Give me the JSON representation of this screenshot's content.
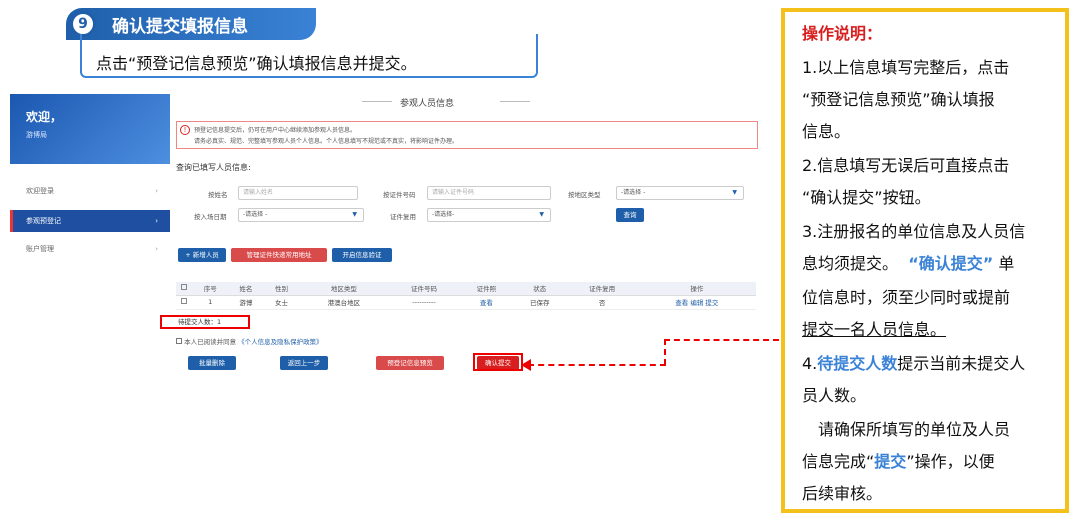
{
  "step": {
    "number": "9",
    "title": "确认提交填报信息",
    "desc": "点击“预登记信息预览”确认填报信息并提交。"
  },
  "sidebar": {
    "welcome_title": "欢迎，",
    "welcome_sub": "游博局",
    "items": [
      {
        "label": "欢迎登录"
      },
      {
        "label": "参观预登记"
      },
      {
        "label": "账户管理"
      }
    ]
  },
  "main": {
    "section_title": "参观人员信息",
    "notice_line1": "预登记信息提交后，仍可在用户中心继续添加参观人员信息。",
    "notice_line2": "请务必真实、规范、完整填写参观人员个人信息。个人信息填写不规范或不真实，将影响证件办理。",
    "query_label": "查询已填写人员信息:",
    "form": {
      "name_label": "按姓名",
      "name_placeholder": "请输入姓名",
      "id_label": "按证件号码",
      "id_placeholder": "请输入证件号码",
      "region_label": "按地区类型",
      "region_value": "-请选择 -",
      "date_label": "按入场日期",
      "date_value": "-请选择 -",
      "reuse_label": "证件复用",
      "reuse_value": "-请选择-",
      "query_btn": "查询"
    },
    "buttons": {
      "add": "+ 新增人员",
      "manage_addr": "管理证件快递常用地址",
      "enable_verify": "开启信息验证"
    },
    "table": {
      "headers": [
        "序号",
        "姓名",
        "性别",
        "地区类型",
        "证件号码",
        "证件照",
        "状态",
        "证件复用",
        "操作"
      ],
      "rows": [
        {
          "index": "1",
          "name": "游博",
          "gender": "女士",
          "region": "港澳台地区",
          "id": "----------",
          "photo": "查看",
          "status": "已保存",
          "reuse": "否",
          "ops": "查看 编辑 提交"
        }
      ]
    },
    "pending": "待提交人数：1",
    "agree_prefix": "本人已阅读并同意",
    "agree_link": "《个人信息及隐私保护政策》",
    "bottom_buttons": {
      "batch_delete": "批量删除",
      "back": "返回上一步",
      "preview": "预登记信息预览",
      "confirm": "确认提交"
    }
  },
  "panel": {
    "title": "操作说明：",
    "lines": [
      "1.以上信息填写完整后，点击",
      "“预登记信息预览”确认填报",
      "信息。",
      "2.信息填写无误后可直接点击",
      "“确认提交”按钮。",
      "3.注册报名的单位信息及人员信",
      "息均须提交。",
      "“确认提交”",
      "单",
      "位信息时，须至少同时或提前",
      "提交一名人员信息。",
      "4.",
      "待提交人数",
      "提示当前未提交人",
      "员人数。",
      "请确保所填写的单位及人员",
      "信息完成“",
      "提交",
      "”操作，以便",
      "后续审核。"
    ]
  },
  "colors": {
    "accent": "#1f5fa9",
    "highlight": "#3a82d6",
    "alert": "#d81e1e",
    "panel_border": "#f3c11a"
  }
}
